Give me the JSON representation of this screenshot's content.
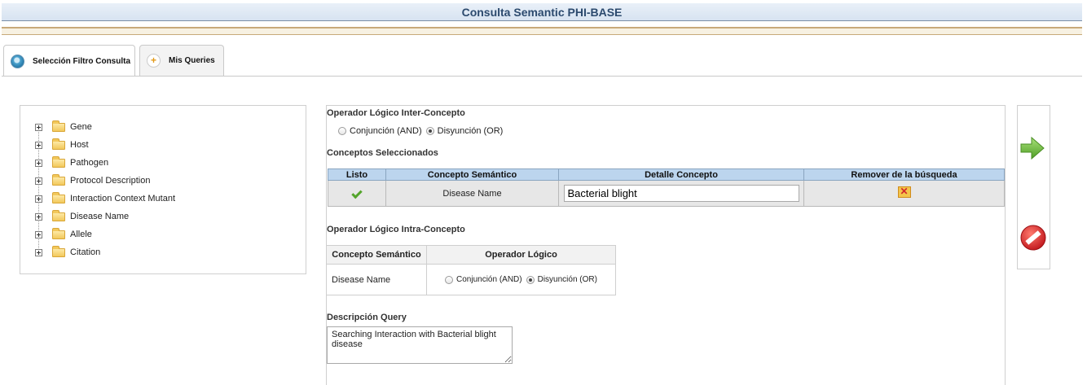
{
  "app_title": "Consulta Semantic PHI-BASE",
  "tabs": [
    {
      "label": "Selección Filtro Consulta",
      "icon": "filter-icon"
    },
    {
      "label": "Mis Queries",
      "icon": "plus-icon"
    }
  ],
  "tree": {
    "items": [
      "Gene",
      "Host",
      "Pathogen",
      "Protocol Description",
      "Interaction Context Mutant",
      "Disease Name",
      "Allele",
      "Citation"
    ]
  },
  "inter": {
    "label": "Operador Lógico Inter-Concepto",
    "option_and": "Conjunción (AND)",
    "option_or": "Disyunción (OR)",
    "selected": "or"
  },
  "selected_concepts": {
    "label": "Conceptos Seleccionados",
    "headers": [
      "Listo",
      "Concepto Semántico",
      "Detalle Concepto",
      "Remover de la búsqueda"
    ],
    "rows": [
      {
        "concept": "Disease Name",
        "detail": "Bacterial blight"
      }
    ]
  },
  "intra": {
    "label": "Operador Lógico Intra-Concepto",
    "headers": [
      "Concepto Semántico",
      "Operador Lógico"
    ],
    "rows": [
      {
        "concept": "Disease Name",
        "option_and": "Conjunción (AND)",
        "option_or": "Disyunción (OR)",
        "selected": "or"
      }
    ]
  },
  "description": {
    "label": "Descripción Query",
    "value": "Searching Interaction with Bacterial blight disease"
  },
  "colors": {
    "header_bg": "#bcd5ee",
    "accent_green": "#6cbf3a",
    "cancel_red": "#d2262b"
  }
}
